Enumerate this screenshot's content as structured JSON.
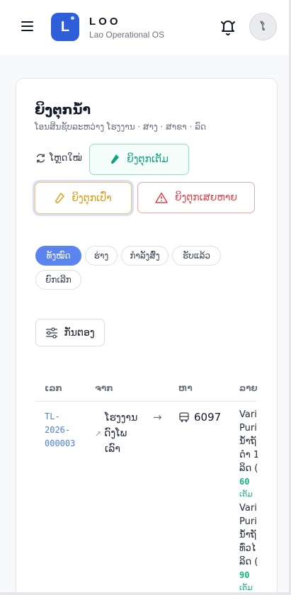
{
  "header": {
    "logo_letter": "L",
    "brand": "LOO",
    "brand_sub": "Lao Operational OS",
    "avatar_initial": "ໂ",
    "icons": [
      "menu-icon",
      "bell-icon"
    ]
  },
  "page": {
    "title": "ຍິງຕຸກນໍ້າ",
    "subtitle": "ໂອນສິນຊັບລະຫວ່າງ ໂຮງງານ · ສາງ · ສາຂາ · ລົດ",
    "refresh_label": "ໂຫຼດໃໝ່",
    "btn_full": "ຍິງຕຸກເຕັມ",
    "btn_empty": "ຍິງຕຸກເປົ່າ",
    "btn_damaged": "ຍິງຕຸກເສຍຫາຍ"
  },
  "filters": {
    "chips": [
      "ທັງໝົດ",
      "ຮ່າງ",
      "ກຳລັງສົ່ງ",
      "ຮັບແລ້ວ",
      "ຍົກເລີກ"
    ],
    "active": "ທັງໝົດ",
    "filter_button": "ກັ່ນຕອງ"
  },
  "table": {
    "headers": [
      "ເລກ",
      "ຈາກ",
      "ຫາ",
      "ລາຍ"
    ],
    "rows": [
      {
        "id_lines": [
          "TL-",
          "2026-",
          "000003"
        ],
        "from_lines": [
          "ໂຮງງານ",
          "ດົງໂພ",
          "ເລົາ"
        ],
        "arrow": "→",
        "to": "6097",
        "items": [
          {
            "lines": [
              "Vari",
              "Puri",
              "ນໍ້າຖັ",
              "ດຳ 1"
            ],
            "qty": "60",
            "unit": "ເຕັມ"
          },
          {
            "lines": [
              "Vari",
              "Puri",
              "ນໍ້າຖັ",
              "ທົ່ວໄ",
              "ລິດ ("
            ],
            "qty": "90",
            "unit": "ເຕັມ"
          }
        ]
      }
    ]
  },
  "colors": {
    "accent": "#2f5fd8",
    "chip_active": "#5b84f0",
    "full": "#10a37f",
    "empty": "#d89b12",
    "damaged": "#e0424a",
    "link": "#4a7fe0"
  }
}
